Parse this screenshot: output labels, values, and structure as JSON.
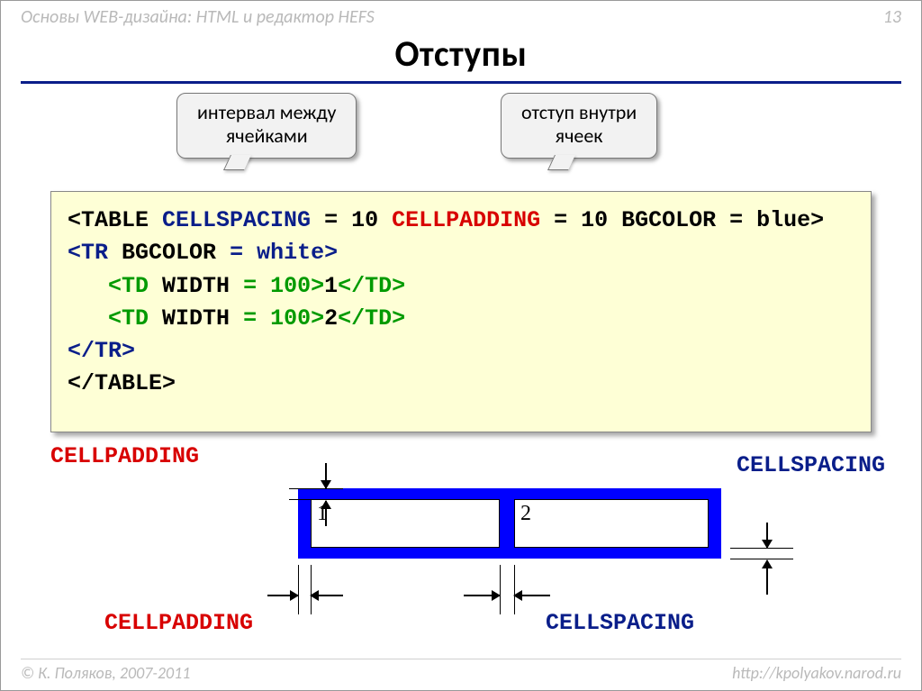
{
  "header": {
    "course": "Основы WEB-дизайна: HTML и редактор HEFS",
    "page": "13"
  },
  "title": "Отступы",
  "callouts": {
    "cellspacing": "интервал между\nячейками",
    "cellpadding": "отступ внутри\nячеек"
  },
  "code": {
    "line1": {
      "table_open": "<TABLE",
      "sp": " ",
      "cs": "CELLSPACING",
      "eq1": " = 10 ",
      "cp": "CELLPADDING",
      "eq2": " = 10 ",
      "bg": "BGCOLOR",
      "eq3": " = blue>",
      "close": ""
    },
    "line2": {
      "tr_open": "<TR",
      "sp": " ",
      "bg": "BGCOLOR",
      "eq": " = white>"
    },
    "line3": {
      "td_open": "<TD",
      "sp": " ",
      "w": "WIDTH",
      "eq": " = 100>",
      "v": "1",
      "td_close": "</TD>"
    },
    "line4": {
      "td_open": "<TD",
      "sp": " ",
      "w": "WIDTH",
      "eq": " = 100>",
      "v": "2",
      "td_close": "</TD>"
    },
    "line5": {
      "tr_close": "</TR>"
    },
    "line6": {
      "table_close": "</TABLE>"
    }
  },
  "diagram": {
    "labels": {
      "cellpadding_top": "CELLPADDING",
      "cellspacing_top": "CELLSPACING",
      "cellpadding_bottom": "CELLPADDING",
      "cellspacing_bottom": "CELLSPACING"
    },
    "cells": {
      "c1": "1",
      "c2": "2"
    }
  },
  "footer": {
    "copyright": "© К. Поляков, 2007-2011",
    "url": "http://kpolyakov.narod.ru"
  }
}
